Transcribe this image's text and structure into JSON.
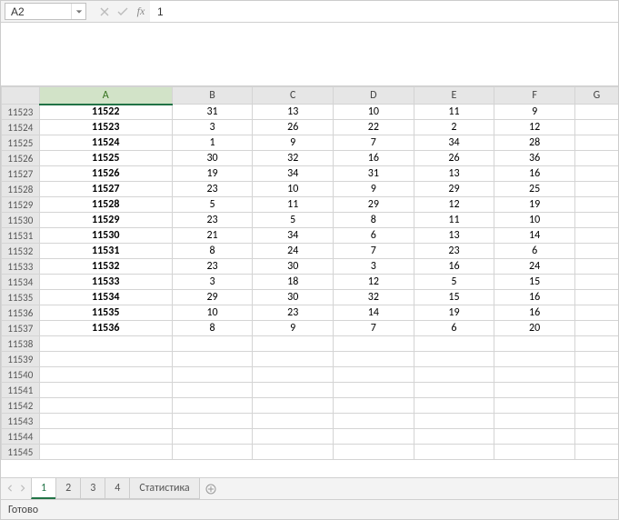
{
  "name_box": {
    "value": "A2"
  },
  "formula_bar": {
    "fx_label": "fx",
    "value": "1"
  },
  "columns": [
    "A",
    "B",
    "C",
    "D",
    "E",
    "F",
    "G"
  ],
  "selected_column": "A",
  "row_start": 11523,
  "empty_rows_after": [
    11538,
    11539,
    11540,
    11541,
    11542,
    11543,
    11544,
    11545
  ],
  "data": [
    {
      "r": 11523,
      "A": "11522",
      "B": "31",
      "C": "13",
      "D": "10",
      "E": "11",
      "F": "9"
    },
    {
      "r": 11524,
      "A": "11523",
      "B": "3",
      "C": "26",
      "D": "22",
      "E": "2",
      "F": "12"
    },
    {
      "r": 11525,
      "A": "11524",
      "B": "1",
      "C": "9",
      "D": "7",
      "E": "34",
      "F": "28"
    },
    {
      "r": 11526,
      "A": "11525",
      "B": "30",
      "C": "32",
      "D": "16",
      "E": "26",
      "F": "36"
    },
    {
      "r": 11527,
      "A": "11526",
      "B": "19",
      "C": "34",
      "D": "31",
      "E": "13",
      "F": "16"
    },
    {
      "r": 11528,
      "A": "11527",
      "B": "23",
      "C": "10",
      "D": "9",
      "E": "29",
      "F": "25"
    },
    {
      "r": 11529,
      "A": "11528",
      "B": "5",
      "C": "11",
      "D": "29",
      "E": "12",
      "F": "19"
    },
    {
      "r": 11530,
      "A": "11529",
      "B": "23",
      "C": "5",
      "D": "8",
      "E": "11",
      "F": "10"
    },
    {
      "r": 11531,
      "A": "11530",
      "B": "21",
      "C": "34",
      "D": "6",
      "E": "13",
      "F": "14"
    },
    {
      "r": 11532,
      "A": "11531",
      "B": "8",
      "C": "24",
      "D": "7",
      "E": "23",
      "F": "6"
    },
    {
      "r": 11533,
      "A": "11532",
      "B": "23",
      "C": "30",
      "D": "3",
      "E": "16",
      "F": "24"
    },
    {
      "r": 11534,
      "A": "11533",
      "B": "3",
      "C": "18",
      "D": "12",
      "E": "5",
      "F": "15"
    },
    {
      "r": 11535,
      "A": "11534",
      "B": "29",
      "C": "30",
      "D": "32",
      "E": "15",
      "F": "16"
    },
    {
      "r": 11536,
      "A": "11535",
      "B": "10",
      "C": "23",
      "D": "14",
      "E": "19",
      "F": "16"
    },
    {
      "r": 11537,
      "A": "11536",
      "B": "8",
      "C": "9",
      "D": "7",
      "E": "6",
      "F": "20"
    }
  ],
  "sheet_tabs": {
    "active_index": 0,
    "items": [
      "1",
      "2",
      "3",
      "4",
      "Статистика"
    ]
  },
  "status": {
    "text": "Готово"
  }
}
